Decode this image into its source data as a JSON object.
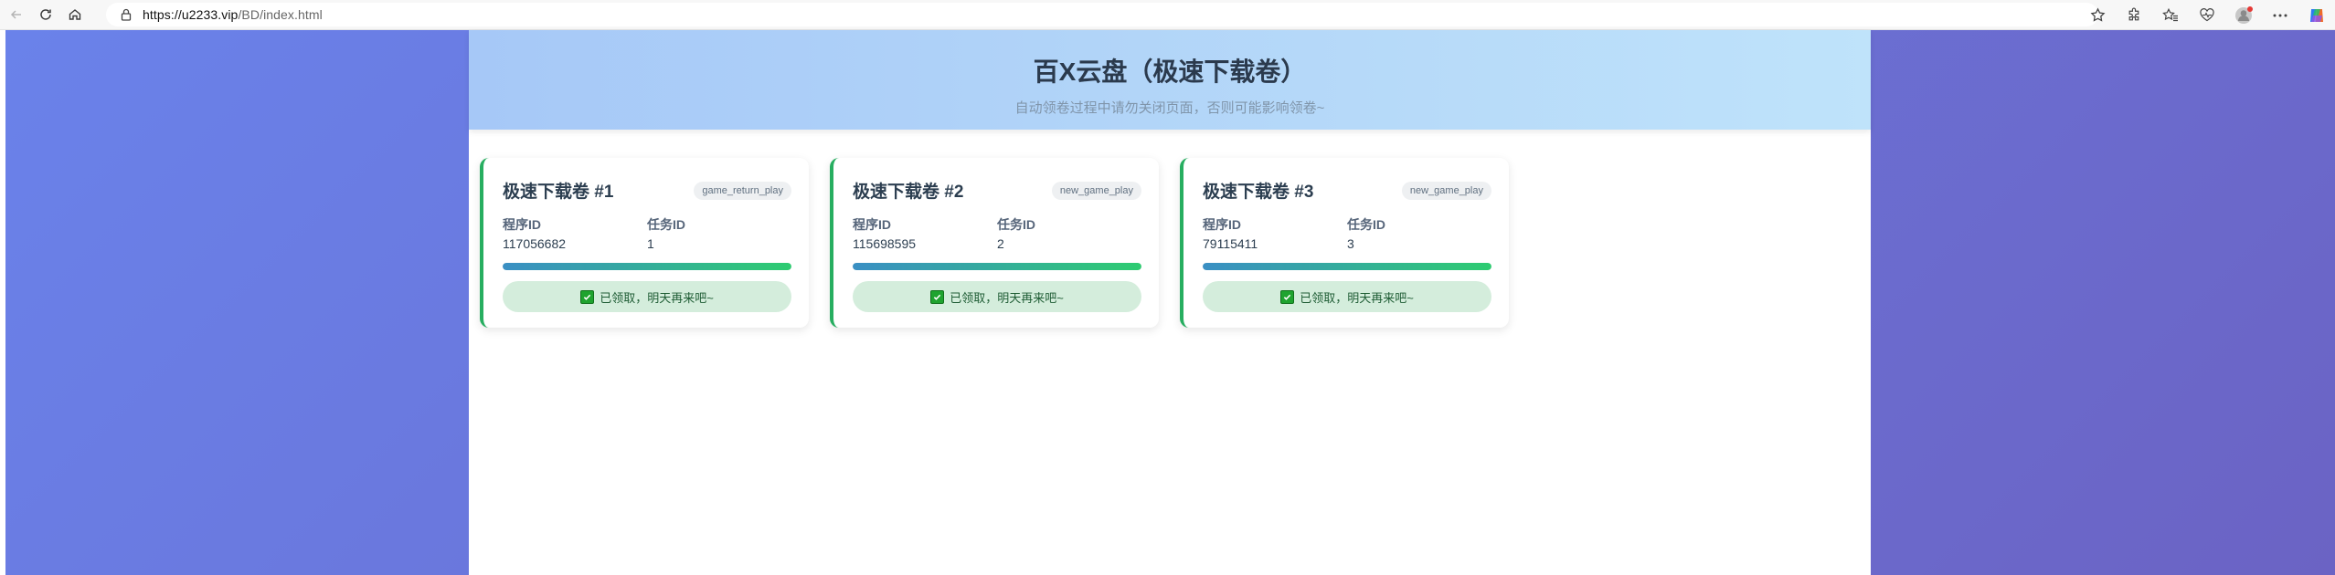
{
  "browser": {
    "url_host": "https://u2233.vip",
    "url_path": "/BD/index.html"
  },
  "page": {
    "title": "百X云盘（极速下载卷）",
    "subtitle": "自动领卷过程中请勿关闭页面，否则可能影响领卷~"
  },
  "cards": [
    {
      "title": "极速下载卷 #1",
      "tag": "game_return_play",
      "program_label": "程序ID",
      "program_id": "117056682",
      "task_label": "任务ID",
      "task_id": "1",
      "progress": 1.0,
      "status": "已领取，明天再来吧~"
    },
    {
      "title": "极速下载卷 #2",
      "tag": "new_game_play",
      "program_label": "程序ID",
      "program_id": "115698595",
      "task_label": "任务ID",
      "task_id": "2",
      "progress": 1.0,
      "status": "已领取，明天再来吧~"
    },
    {
      "title": "极速下载卷 #3",
      "tag": "new_game_play",
      "program_label": "程序ID",
      "program_id": "79115411",
      "task_label": "任务ID",
      "task_id": "3",
      "progress": 1.0,
      "status": "已领取，明天再来吧~"
    }
  ],
  "colors": {
    "accent_green": "#27ae60",
    "status_bg": "#d4eddc",
    "background_gradient_start": "#6a82ea",
    "background_gradient_end": "#6b63c4"
  },
  "icons": {
    "back": "back-arrow-icon",
    "refresh": "refresh-icon",
    "home": "home-icon",
    "lock": "lock-icon",
    "star": "star-icon",
    "extensions": "puzzle-icon",
    "favorites": "favorites-icon",
    "health": "heart-pulse-icon",
    "profile": "profile-icon",
    "more": "more-icon",
    "copilot": "copilot-icon",
    "check": "checkbox-checked-icon"
  }
}
